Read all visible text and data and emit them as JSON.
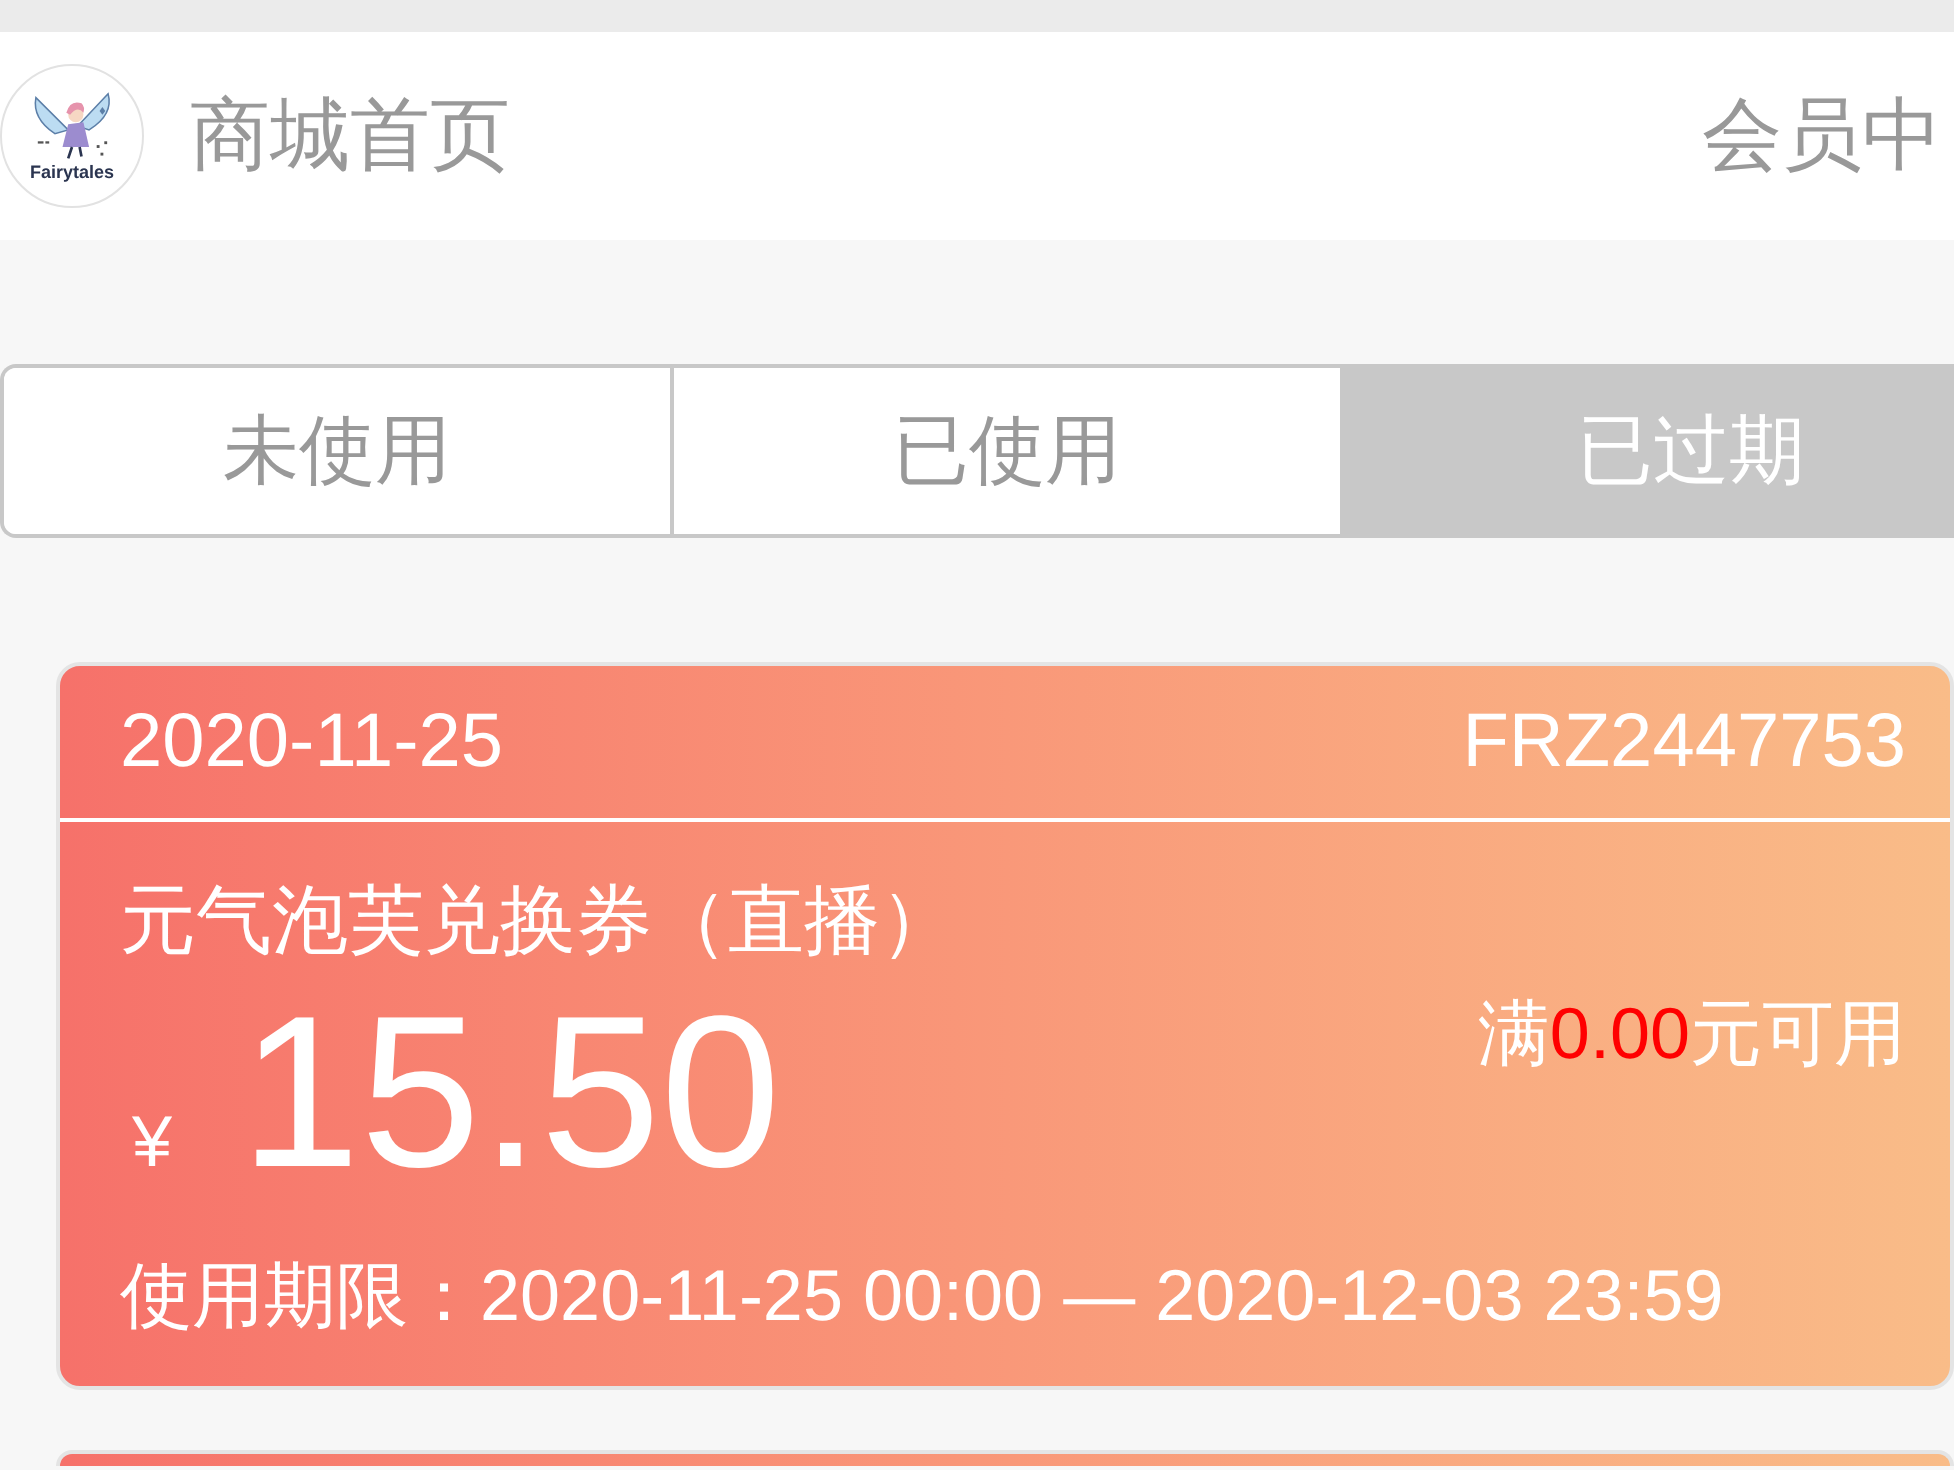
{
  "header": {
    "logo_text": "Fairytales",
    "home_link": "商城首页",
    "member_link": "会员中"
  },
  "tabs": [
    {
      "label": "未使用",
      "selected": false
    },
    {
      "label": "已使用",
      "selected": false
    },
    {
      "label": "已过期",
      "selected": true
    }
  ],
  "coupons": [
    {
      "kind": "full",
      "date": "2020-11-25",
      "code": "FRZ2447753",
      "title": "元气泡芙兑换券（直播）",
      "currency": "¥",
      "amount": "15.50",
      "condition_prefix": "满",
      "condition_amount": "0.00",
      "condition_suffix": "元可用",
      "validity": "使用期限：2020-11-25 00:00 — 2020-12-03 23:59"
    },
    {
      "kind": "cut_off"
    }
  ]
}
